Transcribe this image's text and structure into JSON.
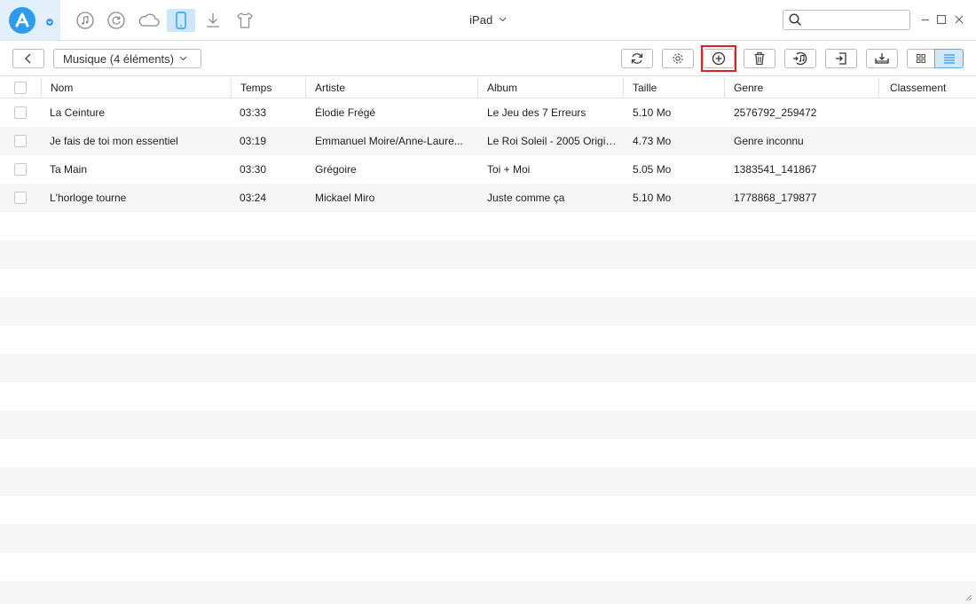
{
  "app": {
    "device_title": "iPad",
    "colors": {
      "accent": "#2d9cf0",
      "active_nav": "#cde6fa",
      "highlight": "#e02020",
      "row_alt": "#f6f6f7"
    },
    "nav_icons": [
      "music-note-icon",
      "history-icon",
      "cloud-icon",
      "device-icon",
      "download-icon",
      "tshirt-icon"
    ]
  },
  "search": {
    "value": "",
    "placeholder": ""
  },
  "toolbar": {
    "category_label": "Musique (4 éléments)",
    "buttons": [
      "back-icon",
      "refresh-icon",
      "settings-icon",
      "add-icon",
      "delete-icon",
      "to-itunes-icon",
      "to-pc-icon",
      "to-device-icon",
      "grid-view-icon",
      "list-view-icon"
    ]
  },
  "table": {
    "columns": [
      "Nom",
      "Temps",
      "Artiste",
      "Album",
      "Taille",
      "Genre",
      "Classement"
    ],
    "rows": [
      {
        "nom": "La Ceinture",
        "temps": "03:33",
        "artiste": "Élodie Frégé",
        "album": "Le Jeu des 7 Erreurs",
        "taille": "5.10 Mo",
        "genre": "2576792_259472",
        "classement": ""
      },
      {
        "nom": "Je fais de toi mon essentiel",
        "temps": "03:19",
        "artiste": "Emmanuel Moire/Anne-Laure...",
        "album": "Le Roi Soleil - 2005 Origin...",
        "taille": "4.73 Mo",
        "genre": "Genre inconnu",
        "classement": ""
      },
      {
        "nom": "Ta Main",
        "temps": "03:30",
        "artiste": "Grégoire",
        "album": "Toi + Moi",
        "taille": "5.05 Mo",
        "genre": "1383541_141867",
        "classement": ""
      },
      {
        "nom": "L'horloge tourne",
        "temps": "03:24",
        "artiste": "Mickael Miro",
        "album": "Juste comme ça",
        "taille": "5.10 Mo",
        "genre": "1778868_179877",
        "classement": ""
      }
    ]
  }
}
